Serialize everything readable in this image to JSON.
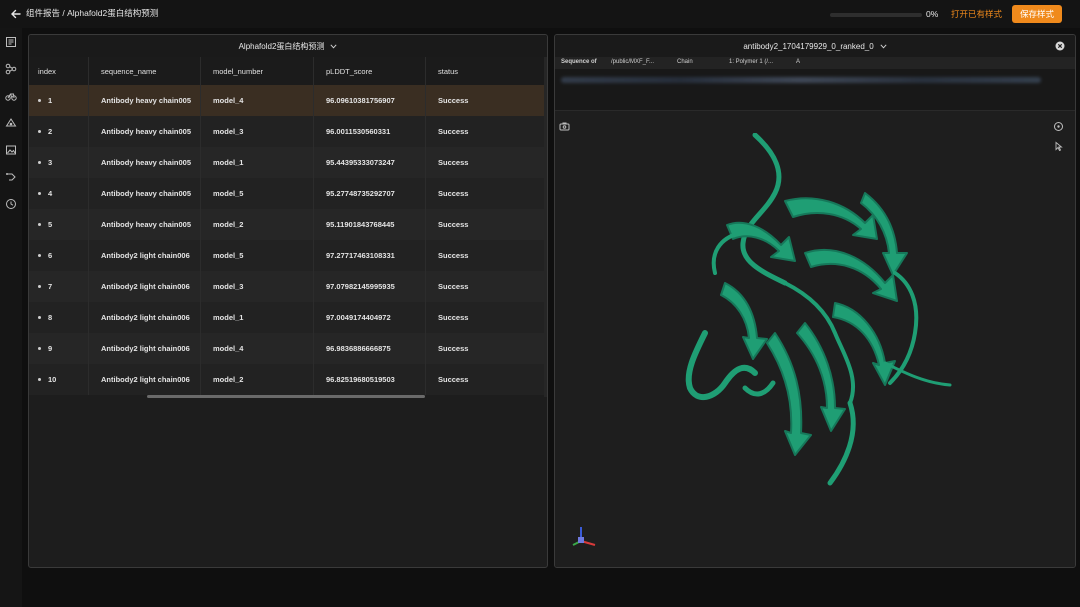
{
  "topbar": {
    "breadcrumb": "组件报告 / Alphafold2蛋白结构预测",
    "progress_percent": "0%",
    "progress_value": 0,
    "open_style_label": "打开已有样式",
    "save_style_label": "保存样式",
    "accent_color": "#f08a1c"
  },
  "rail": {
    "icons": [
      "layers-icon",
      "nodes-icon",
      "bike-icon",
      "cloud-icon",
      "image-icon",
      "route-icon",
      "clock-icon"
    ]
  },
  "table_panel": {
    "title": "Alphafold2蛋白结构预测",
    "columns": [
      "index",
      "sequence_name",
      "model_number",
      "pLDDT_score",
      "status"
    ],
    "rows": [
      {
        "index": "1",
        "sequence_name": "Antibody heavy chain005",
        "model_number": "model_4",
        "plddt": "96.09610381756907",
        "status": "Success"
      },
      {
        "index": "2",
        "sequence_name": "Antibody heavy chain005",
        "model_number": "model_3",
        "plddt": "96.0011530560331",
        "status": "Success"
      },
      {
        "index": "3",
        "sequence_name": "Antibody heavy chain005",
        "model_number": "model_1",
        "plddt": "95.44395333073247",
        "status": "Success"
      },
      {
        "index": "4",
        "sequence_name": "Antibody heavy chain005",
        "model_number": "model_5",
        "plddt": "95.27748735292707",
        "status": "Success"
      },
      {
        "index": "5",
        "sequence_name": "Antibody heavy chain005",
        "model_number": "model_2",
        "plddt": "95.11901843768445",
        "status": "Success"
      },
      {
        "index": "6",
        "sequence_name": "Antibody2 light chain006",
        "model_number": "model_5",
        "plddt": "97.27717463108331",
        "status": "Success"
      },
      {
        "index": "7",
        "sequence_name": "Antibody2 light chain006",
        "model_number": "model_3",
        "plddt": "97.07982145995935",
        "status": "Success"
      },
      {
        "index": "8",
        "sequence_name": "Antibody2 light chain006",
        "model_number": "model_1",
        "plddt": "97.0049174404972",
        "status": "Success"
      },
      {
        "index": "9",
        "sequence_name": "Antibody2 light chain006",
        "model_number": "model_4",
        "plddt": "96.9836886666875",
        "status": "Success"
      },
      {
        "index": "10",
        "sequence_name": "Antibody2 light chain006",
        "model_number": "model_2",
        "plddt": "96.82519680519503",
        "status": "Success"
      }
    ]
  },
  "viewer_panel": {
    "title": "antibody2_1704179929_0_ranked_0",
    "sequence_label": "Sequence of",
    "sequence_path": "/public/MXF_F...",
    "chain_label": "Chain",
    "polymer_label": "1: Polymer 1 (/...",
    "chain_value": "A",
    "protein_color": "#1f9e74"
  }
}
